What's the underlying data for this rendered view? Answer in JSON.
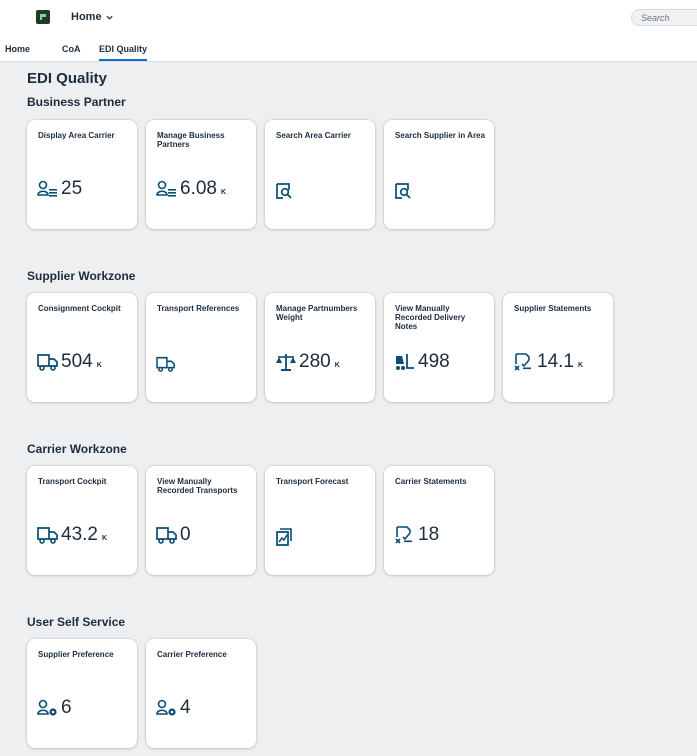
{
  "header": {
    "home_menu_label": "Home",
    "search_placeholder": "Search"
  },
  "tabs": [
    {
      "label": "Home"
    },
    {
      "label": "CoA"
    },
    {
      "label": "EDI Quality",
      "active": true
    }
  ],
  "page_title": "EDI Quality",
  "sections": [
    {
      "title": "Business Partner",
      "tiles": [
        {
          "title": "Display Area Carrier",
          "icon": "user-list-icon",
          "value": "25",
          "unit": ""
        },
        {
          "title": "Manage Business Partners",
          "icon": "user-list-icon",
          "value": "6.08",
          "unit": "K"
        },
        {
          "title": "Search Area Carrier",
          "icon": "search-document-icon",
          "value": "",
          "unit": ""
        },
        {
          "title": "Search Supplier in Area",
          "icon": "search-document-icon",
          "value": "",
          "unit": ""
        }
      ]
    },
    {
      "title": "Supplier Workzone",
      "tiles": [
        {
          "title": "Consignment Cockpit",
          "icon": "truck-icon",
          "value": "504",
          "unit": "K"
        },
        {
          "title": "Transport References",
          "icon": "truck-icon",
          "value": "",
          "unit": ""
        },
        {
          "title": "Manage Partnumbers Weight",
          "icon": "weight-scale-icon",
          "value": "280",
          "unit": "K"
        },
        {
          "title": "View Manually Recorded Delivery Notes",
          "icon": "forklift-icon",
          "value": "498",
          "unit": ""
        },
        {
          "title": "Supplier Statements",
          "icon": "statement-icon",
          "value": "14.1",
          "unit": "K"
        }
      ]
    },
    {
      "title": "Carrier Workzone",
      "tiles": [
        {
          "title": "Transport Cockpit",
          "icon": "truck-icon",
          "value": "43.2",
          "unit": "K"
        },
        {
          "title": "View Manually Recorded Transports",
          "icon": "truck-icon",
          "value": "0",
          "unit": ""
        },
        {
          "title": "Transport Forecast",
          "icon": "forecast-icon",
          "value": "",
          "unit": ""
        },
        {
          "title": "Carrier Statements",
          "icon": "statement-icon",
          "value": "18",
          "unit": ""
        }
      ]
    },
    {
      "title": "User Self Service",
      "tiles": [
        {
          "title": "Supplier Preference",
          "icon": "user-settings-icon",
          "value": "6",
          "unit": ""
        },
        {
          "title": "Carrier Preference",
          "icon": "user-settings-icon",
          "value": "4",
          "unit": ""
        }
      ]
    }
  ],
  "colors": {
    "accent": "#0a6ed1",
    "icon": "#0a4e74",
    "background": "#edeff0",
    "tile": "#ffffff"
  }
}
